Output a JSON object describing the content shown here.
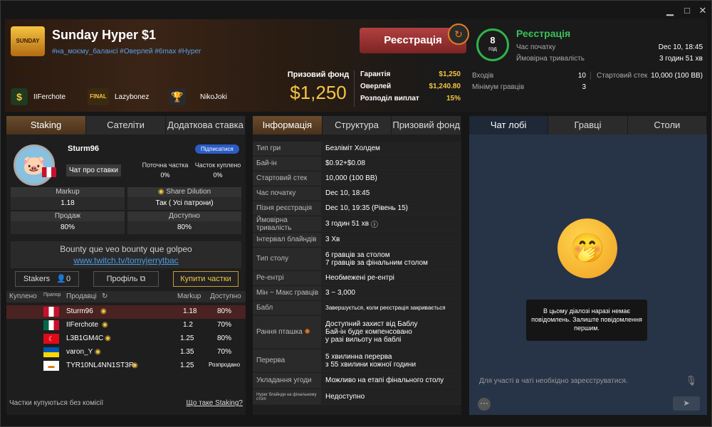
{
  "window": {
    "minimize": "▁",
    "maximize": "□",
    "close": "✕"
  },
  "tournament": {
    "logo_text": "SUNDAY HYPER",
    "name": "Sunday Hyper $1",
    "tags": "#на_моєму_балансі #Оверлей #6max #Hyper"
  },
  "winners": [
    {
      "icon": "$",
      "name": "IIFerchote"
    },
    {
      "icon": "FINAL",
      "name": "Lazybonez"
    },
    {
      "icon": "🏆",
      "name": "NikoJoki"
    }
  ],
  "prize": {
    "label": "Призовий фонд",
    "value": "$1,250"
  },
  "prize_info": [
    {
      "k": "Гарантія",
      "v": "$1,250"
    },
    {
      "k": "Оверлей",
      "v": "$1,240.80"
    },
    {
      "k": "Розподіл виплат",
      "v": "15%"
    }
  ],
  "register_button": "Реєстрація",
  "players_circle": {
    "number": "8",
    "unit": "год"
  },
  "status": "Реєстрація",
  "time_info": [
    {
      "k": "Час початку",
      "v": "Dec 10, 18:45"
    },
    {
      "k": "Ймовірна тривалість",
      "v": "3 годин 51 хв"
    }
  ],
  "entries_info": [
    {
      "k": "Входів",
      "v": "10"
    },
    {
      "k": "Мінімум гравців",
      "v": "3"
    }
  ],
  "start_stack": {
    "k": "Стартовий стек",
    "v": "10,000 (100 BB)"
  },
  "left_tabs": [
    "Staking",
    "Сателіти",
    "Додаткова ставка"
  ],
  "staker": {
    "name": "Sturm96",
    "chat": "Чат про ставки",
    "subscribe": "Підписатися",
    "cur_label": "Поточна частка",
    "cur_value": "0%",
    "share_label": "Часток куплено",
    "share_value": "0%",
    "boxes": [
      {
        "h": "Markup",
        "v": "1.18"
      },
      {
        "h": "Share Dilution",
        "v": "Так ( Усі патрони)"
      },
      {
        "h": "Продаж",
        "v": "80%"
      },
      {
        "h": "Доступно",
        "v": "80%"
      }
    ],
    "bounty_text": "Bounty que veo bounty que golpeo",
    "bounty_link": "www.twitch.tv/tomyjerrytbac",
    "stakers_label": "Stakers",
    "stakers_count": "0",
    "profile": "Профіль",
    "buy": "Купити частки"
  },
  "sellers_table": {
    "headers": [
      "Куплено",
      "Прапор",
      "Продавці",
      "Markup",
      "Доступно"
    ],
    "rows": [
      {
        "name": "Sturm96",
        "markup": "1.18",
        "avail": "80%",
        "flag": "mx"
      },
      {
        "name": "IIFerchote",
        "markup": "1.2",
        "avail": "70%",
        "flag": "mx"
      },
      {
        "name": "L3B1GM4C",
        "markup": "1.25",
        "avail": "80%",
        "flag": "tr"
      },
      {
        "name": "varon_Y",
        "markup": "1.35",
        "avail": "70%",
        "flag": "ua"
      },
      {
        "name": "TYR10NL4NN1ST3R",
        "markup": "1.25",
        "avail": "Розпродано",
        "flag": "cy"
      }
    ]
  },
  "left_footer": {
    "note": "Частки купуються без комісії",
    "link": "Що таке Staking?"
  },
  "mid_tabs": [
    "Інформація",
    "Структура",
    "Призовий фонд"
  ],
  "info_rows": [
    {
      "k": "Тип гри",
      "v": "Безліміт Холдем"
    },
    {
      "k": "Бай-ін",
      "v": "$0.92+$0.08"
    },
    {
      "k": "Стартовий стек",
      "v": "10,000 (100 BB)"
    },
    {
      "k": "Час початку",
      "v": "Dec 10, 18:45"
    },
    {
      "k": "Пізня реєстрація",
      "v": "Dec 10, 19:35 (Рівень 15)"
    },
    {
      "k": "Ймовірна тривалість",
      "v": "3 годин 51 хв"
    },
    {
      "k": "Інтервал блайндів",
      "v": "3 Хв"
    },
    {
      "k": "Тип столу",
      "v": "6 гравців за столом\n7 гравців за фінальним столом"
    },
    {
      "k": "Ре-ентрі",
      "v": "Необмежені ре-ентрі"
    },
    {
      "k": "Мін ~ Макс гравців",
      "v": "3 ~ 3,000"
    },
    {
      "k": "Бабл",
      "v": "Завершується, коли реєстрація закривається"
    },
    {
      "k": "Рання пташка",
      "v": "Доступний захист від Баблу\nБай-ін буде компенсовано\nу разі вильоту на баблі"
    },
    {
      "k": "Перерва",
      "v": "5 хвилинна перерва\nз 55 хвилини кожної години"
    },
    {
      "k": "Укладання угоди",
      "v": "Можливо на етапі фінального столу"
    },
    {
      "k": "Hyper блайнди на фінальному столі",
      "v": "Недоступно"
    }
  ],
  "right_tabs": [
    "Чат лобі",
    "Гравці",
    "Столи"
  ],
  "chat": {
    "empty": "В цьому діалозі наразі немає повідомлень. Залиште повідомлення першим.",
    "placeholder": "Для участі в чаті необхідно зареєструватися.",
    "send": "➤",
    "emoji": "🤭"
  },
  "colors": {
    "accent_gold": "#f5c542",
    "status_green": "#39c15a",
    "register_red": "#a33535"
  }
}
